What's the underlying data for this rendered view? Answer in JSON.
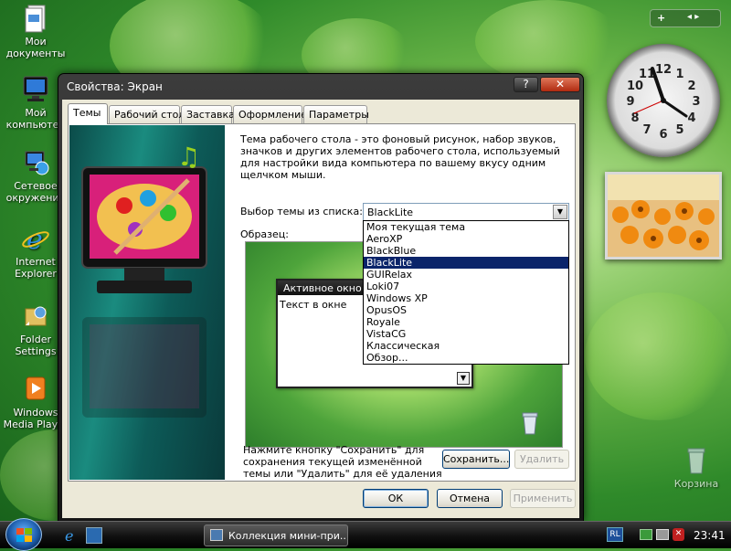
{
  "desktop": {
    "icons": [
      {
        "label": "Мои документы",
        "icon": "documents-icon"
      },
      {
        "label": "Мой компьютер",
        "icon": "computer-icon"
      },
      {
        "label": "Сетевое окружение",
        "icon": "network-icon"
      },
      {
        "label": "Internet Explorer",
        "icon": "ie-icon"
      },
      {
        "label": "Folder Settings",
        "icon": "folder-settings-icon"
      },
      {
        "label": "Windows Media Player",
        "icon": "media-player-icon"
      }
    ],
    "recycle_bin_label": "Корзина"
  },
  "gadgets": {
    "add_label": "+",
    "nav_label": "◂ ▸",
    "clock_time": "4:39"
  },
  "dialog": {
    "title": "Свойства: Экран",
    "help_label": "?",
    "close_label": "✕",
    "tabs": [
      "Темы",
      "Рабочий стол",
      "Заставка",
      "Оформление",
      "Параметры"
    ],
    "description": "Тема рабочего стола - это фоновый рисунок, набор звуков, значков и других элементов рабочего стола, используемый для настройки вида компьютера по вашему вкусу одним щелчком мыши.",
    "theme_label": "Выбор темы из списка:",
    "theme_selected": "BlackLite",
    "sample_label": "Образец:",
    "theme_options": [
      "Моя текущая тема",
      "AeroXP",
      "BlackBlue",
      "BlackLite",
      "GUIRelax",
      "Loki07",
      "Windows XP",
      "OpusOS",
      "Royale",
      "VistaCG",
      "Классическая",
      "Обзор..."
    ],
    "selected_index": 3,
    "preview": {
      "active_window_title": "Активное окно",
      "window_text": "Текст в окне"
    },
    "hint": "Нажмите кнопку \"Сохранить\" для сохранения текущей изменённой темы или \"Удалить\" для её удаления",
    "save_label": "Сохранить...",
    "delete_label": "Удалить",
    "ok_label": "ОК",
    "cancel_label": "Отмена",
    "apply_label": "Применить"
  },
  "taskbar": {
    "task_label": "Коллекция мини-при...",
    "language": "RL",
    "time": "23:41"
  }
}
